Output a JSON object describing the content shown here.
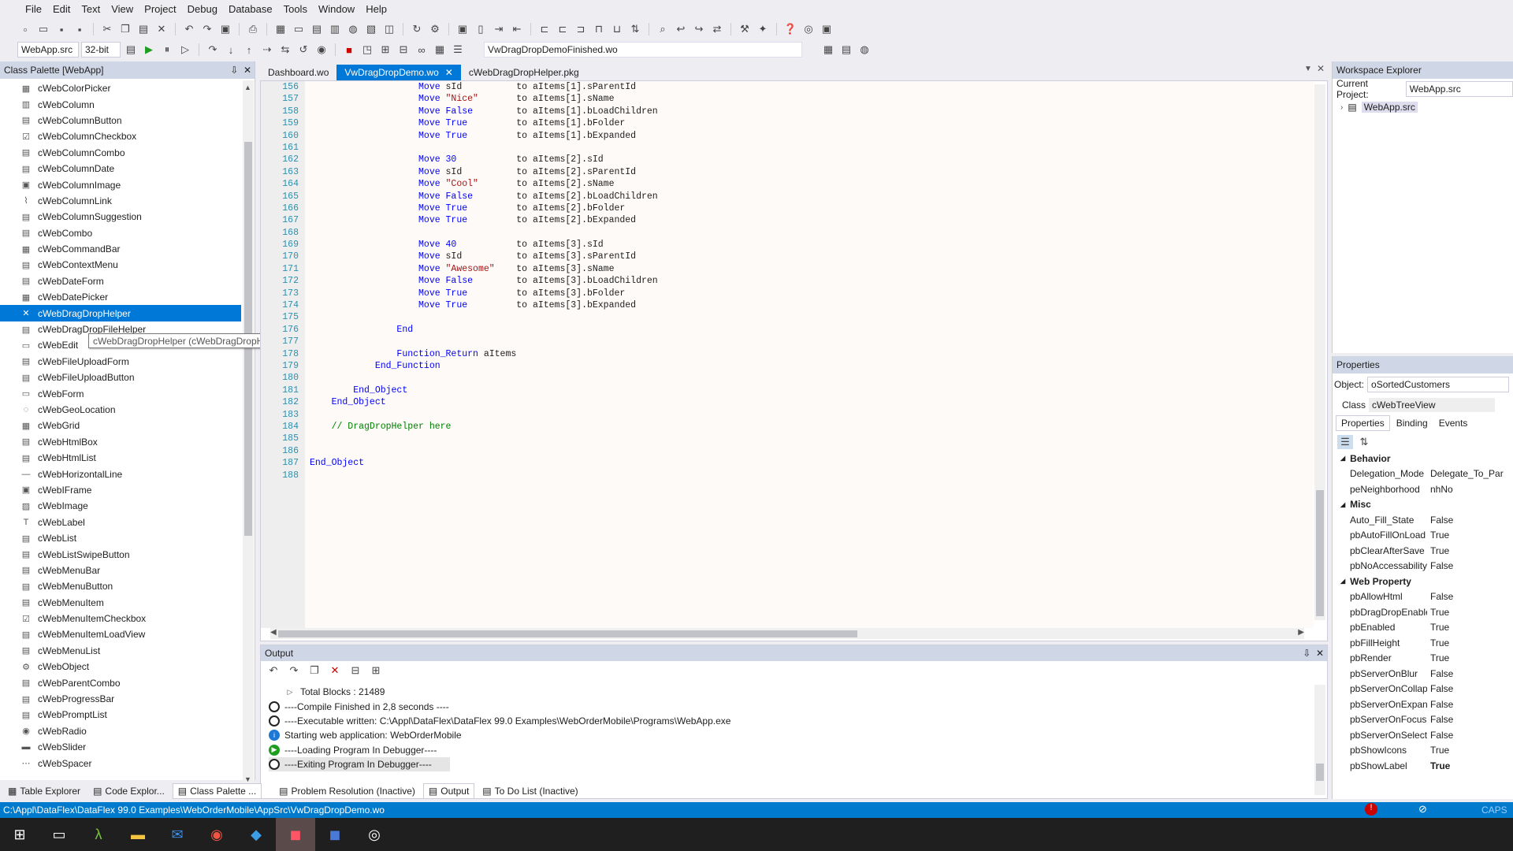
{
  "menu": [
    "File",
    "Edit",
    "Text",
    "View",
    "Project",
    "Debug",
    "Database",
    "Tools",
    "Window",
    "Help"
  ],
  "toolbar": {
    "project_select": "WebApp.src",
    "bitness_select": "32-bit",
    "file_select": "VwDragDropDemoFinished.wo"
  },
  "class_palette": {
    "title": "Class Palette [WebApp]",
    "items": [
      "cWebColorPicker",
      "cWebColumn",
      "cWebColumnButton",
      "cWebColumnCheckbox",
      "cWebColumnCombo",
      "cWebColumnDate",
      "cWebColumnImage",
      "cWebColumnLink",
      "cWebColumnSuggestion",
      "cWebCombo",
      "cWebCommandBar",
      "cWebContextMenu",
      "cWebDateForm",
      "cWebDatePicker",
      "cWebDragDropHelper",
      "cWebDragDropFileHelper",
      "cWebEdit",
      "cWebFileUploadForm",
      "cWebFileUploadButton",
      "cWebForm",
      "cWebGeoLocation",
      "cWebGrid",
      "cWebHtmlBox",
      "cWebHtmlList",
      "cWebHorizontalLine",
      "cWebIFrame",
      "cWebImage",
      "cWebLabel",
      "cWebList",
      "cWebListSwipeButton",
      "cWebMenuBar",
      "cWebMenuButton",
      "cWebMenuItem",
      "cWebMenuItemCheckbox",
      "cWebMenuItemLoadView",
      "cWebMenuList",
      "cWebObject",
      "cWebParentCombo",
      "cWebProgressBar",
      "cWebPromptList",
      "cWebRadio",
      "cWebSlider",
      "cWebSpacer"
    ],
    "selected_index": 14,
    "tooltip": "cWebDragDropHelper (cWebDragDropHelper.pkg)"
  },
  "doc_tabs": [
    {
      "label": "Dashboard.wo",
      "active": false
    },
    {
      "label": "VwDragDropDemo.wo",
      "active": true
    },
    {
      "label": "cWebDragDropHelper.pkg",
      "active": false
    }
  ],
  "editor": {
    "lines": [
      {
        "n": "156",
        "code": [
          [
            "kw",
            "                    Move "
          ],
          [
            "id",
            "sId          to aItems[1].sParentId"
          ]
        ]
      },
      {
        "n": "157",
        "code": [
          [
            "kw",
            "                    Move "
          ],
          [
            "st",
            "\"Nice\""
          ],
          [
            "id",
            "       to aItems[1].sName"
          ]
        ]
      },
      {
        "n": "158",
        "code": [
          [
            "kw",
            "                    Move False"
          ],
          [
            "id",
            "        to aItems[1].bLoadChildren"
          ]
        ]
      },
      {
        "n": "159",
        "code": [
          [
            "kw",
            "                    Move True"
          ],
          [
            "id",
            "         to aItems[1].bFolder"
          ]
        ]
      },
      {
        "n": "160",
        "code": [
          [
            "kw",
            "                    Move True"
          ],
          [
            "id",
            "         to aItems[1].bExpanded"
          ]
        ]
      },
      {
        "n": "161",
        "code": []
      },
      {
        "n": "162",
        "code": [
          [
            "kw",
            "                    Move 30"
          ],
          [
            "id",
            "           to aItems[2].sId"
          ]
        ]
      },
      {
        "n": "163",
        "code": [
          [
            "kw",
            "                    Move "
          ],
          [
            "id",
            "sId          to aItems[2].sParentId"
          ]
        ]
      },
      {
        "n": "164",
        "code": [
          [
            "kw",
            "                    Move "
          ],
          [
            "st",
            "\"Cool\""
          ],
          [
            "id",
            "       to aItems[2].sName"
          ]
        ]
      },
      {
        "n": "165",
        "code": [
          [
            "kw",
            "                    Move False"
          ],
          [
            "id",
            "        to aItems[2].bLoadChildren"
          ]
        ]
      },
      {
        "n": "166",
        "code": [
          [
            "kw",
            "                    Move True"
          ],
          [
            "id",
            "         to aItems[2].bFolder"
          ]
        ]
      },
      {
        "n": "167",
        "code": [
          [
            "kw",
            "                    Move True"
          ],
          [
            "id",
            "         to aItems[2].bExpanded"
          ]
        ]
      },
      {
        "n": "168",
        "code": []
      },
      {
        "n": "169",
        "code": [
          [
            "kw",
            "                    Move 40"
          ],
          [
            "id",
            "           to aItems[3].sId"
          ]
        ]
      },
      {
        "n": "170",
        "code": [
          [
            "kw",
            "                    Move "
          ],
          [
            "id",
            "sId          to aItems[3].sParentId"
          ]
        ]
      },
      {
        "n": "171",
        "code": [
          [
            "kw",
            "                    Move "
          ],
          [
            "st",
            "\"Awesome\""
          ],
          [
            "id",
            "    to aItems[3].sName"
          ]
        ]
      },
      {
        "n": "172",
        "code": [
          [
            "kw",
            "                    Move False"
          ],
          [
            "id",
            "        to aItems[3].bLoadChildren"
          ]
        ]
      },
      {
        "n": "173",
        "code": [
          [
            "kw",
            "                    Move True"
          ],
          [
            "id",
            "         to aItems[3].bFolder"
          ]
        ]
      },
      {
        "n": "174",
        "code": [
          [
            "kw",
            "                    Move True"
          ],
          [
            "id",
            "         to aItems[3].bExpanded"
          ]
        ]
      },
      {
        "n": "175",
        "code": []
      },
      {
        "n": "176",
        "code": [
          [
            "kw",
            "                End"
          ]
        ]
      },
      {
        "n": "177",
        "code": []
      },
      {
        "n": "178",
        "code": [
          [
            "kw",
            "                Function_Return "
          ],
          [
            "id",
            "aItems"
          ]
        ]
      },
      {
        "n": "179",
        "code": [
          [
            "kw",
            "            End_Function"
          ]
        ]
      },
      {
        "n": "180",
        "code": []
      },
      {
        "n": "181",
        "code": [
          [
            "kw",
            "        End_Object"
          ]
        ]
      },
      {
        "n": "182",
        "code": [
          [
            "kw",
            "    End_Object"
          ]
        ]
      },
      {
        "n": "183",
        "code": []
      },
      {
        "n": "184",
        "code": [
          [
            "cm",
            "    // DragDropHelper here"
          ]
        ]
      },
      {
        "n": "185",
        "code": []
      },
      {
        "n": "186",
        "code": []
      },
      {
        "n": "187",
        "code": [
          [
            "kw",
            "End_Object"
          ]
        ]
      },
      {
        "n": "188",
        "code": []
      }
    ]
  },
  "output": {
    "title": "Output",
    "lines": [
      {
        "icon": "expand",
        "text": "Total Blocks   : 21489"
      },
      {
        "icon": "circle",
        "text": "----Compile Finished in 2,8 seconds ----"
      },
      {
        "icon": "circle",
        "text": "----Executable written: C:\\Appl\\DataFlex\\DataFlex 99.0 Examples\\WebOrderMobile\\Programs\\WebApp.exe"
      },
      {
        "icon": "info",
        "text": "Starting web application: WebOrderMobile"
      },
      {
        "icon": "play",
        "text": "----Loading Program In Debugger----"
      },
      {
        "icon": "circle",
        "text": "----Exiting Program In Debugger----"
      }
    ]
  },
  "bottom_tabs": [
    "Table Explorer",
    "Code Explor...",
    "Class Palette ...",
    "Problem Resolution (Inactive)",
    "Output",
    "To Do List (Inactive)"
  ],
  "status_path": "C:\\Appl\\DataFlex\\DataFlex 99.0 Examples\\WebOrderMobile\\AppSrc\\VwDragDropDemo.wo",
  "status_caps": "CAPS",
  "workspace": {
    "title": "Workspace Explorer",
    "current_project_label": "Current Project:",
    "current_project": "WebApp.src",
    "tree_root": "WebApp.src"
  },
  "properties": {
    "title": "Properties",
    "object_label": "Object:",
    "object": "oSortedCustomers",
    "class_label": "Class",
    "class": "cWebTreeView",
    "tabs": [
      "Properties",
      "Binding",
      "Events"
    ],
    "groups": [
      {
        "name": "Behavior",
        "rows": [
          [
            "Delegation_Mode",
            "Delegate_To_Par"
          ],
          [
            "peNeighborhood",
            "nhNo"
          ]
        ]
      },
      {
        "name": "Misc",
        "rows": [
          [
            "Auto_Fill_State",
            "False"
          ],
          [
            "pbAutoFillOnLoad",
            "True"
          ],
          [
            "pbClearAfterSave",
            "True"
          ],
          [
            "pbNoAccessabilityCh",
            "False"
          ]
        ]
      },
      {
        "name": "Web Property",
        "rows": [
          [
            "pbAllowHtml",
            "False"
          ],
          [
            "pbDragDropEnabled",
            "True"
          ],
          [
            "pbEnabled",
            "True"
          ],
          [
            "pbFillHeight",
            "True"
          ],
          [
            "pbRender",
            "True"
          ],
          [
            "pbServerOnBlur",
            "False"
          ],
          [
            "pbServerOnCollapse",
            "False"
          ],
          [
            "pbServerOnExpand",
            "False"
          ],
          [
            "pbServerOnFocus",
            "False"
          ],
          [
            "pbServerOnSelect",
            "False"
          ],
          [
            "pbShowIcons",
            "True"
          ],
          [
            "pbShowLabel",
            "True"
          ]
        ]
      }
    ]
  },
  "colors": {
    "accent": "#0078d7",
    "statusbar": "#007acc",
    "keyword": "#0000ff",
    "string": "#a31515",
    "comment": "#008000"
  }
}
